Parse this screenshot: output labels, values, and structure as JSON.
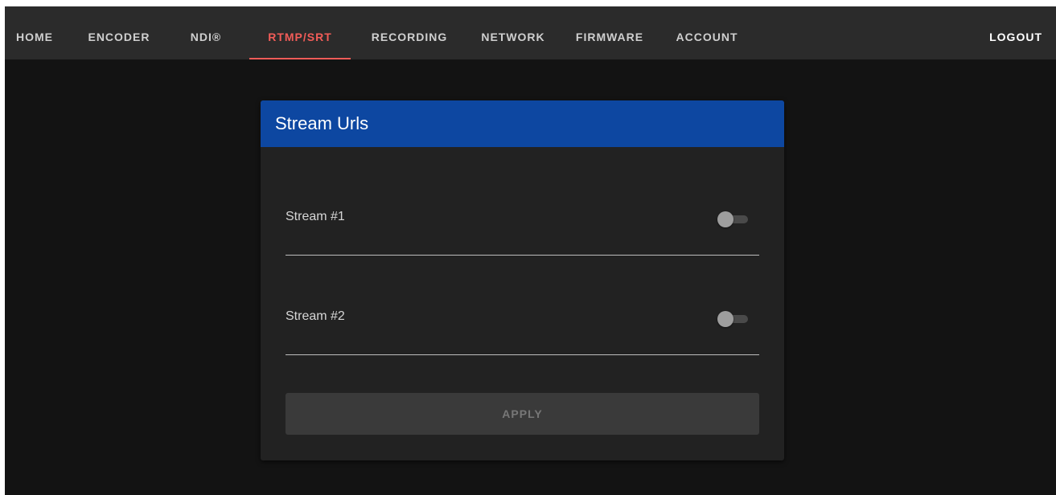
{
  "nav": {
    "tabs": [
      {
        "label": "HOME"
      },
      {
        "label": "ENCODER"
      },
      {
        "label": "NDI®"
      },
      {
        "label": "RTMP/SRT",
        "active": true
      },
      {
        "label": "RECORDING"
      },
      {
        "label": "NETWORK"
      },
      {
        "label": "FIRMWARE"
      },
      {
        "label": "ACCOUNT"
      }
    ],
    "logout_label": "LOGOUT"
  },
  "card": {
    "title": "Stream Urls",
    "streams": [
      {
        "label": "Stream #1",
        "enabled": false
      },
      {
        "label": "Stream #2",
        "enabled": false
      }
    ],
    "apply_label": "APPLY"
  },
  "colors": {
    "header_blue": "#0d47a1",
    "active_tab": "#f25c58",
    "background": "#131313",
    "card": "#222222",
    "topbar": "#2b2b2b"
  }
}
